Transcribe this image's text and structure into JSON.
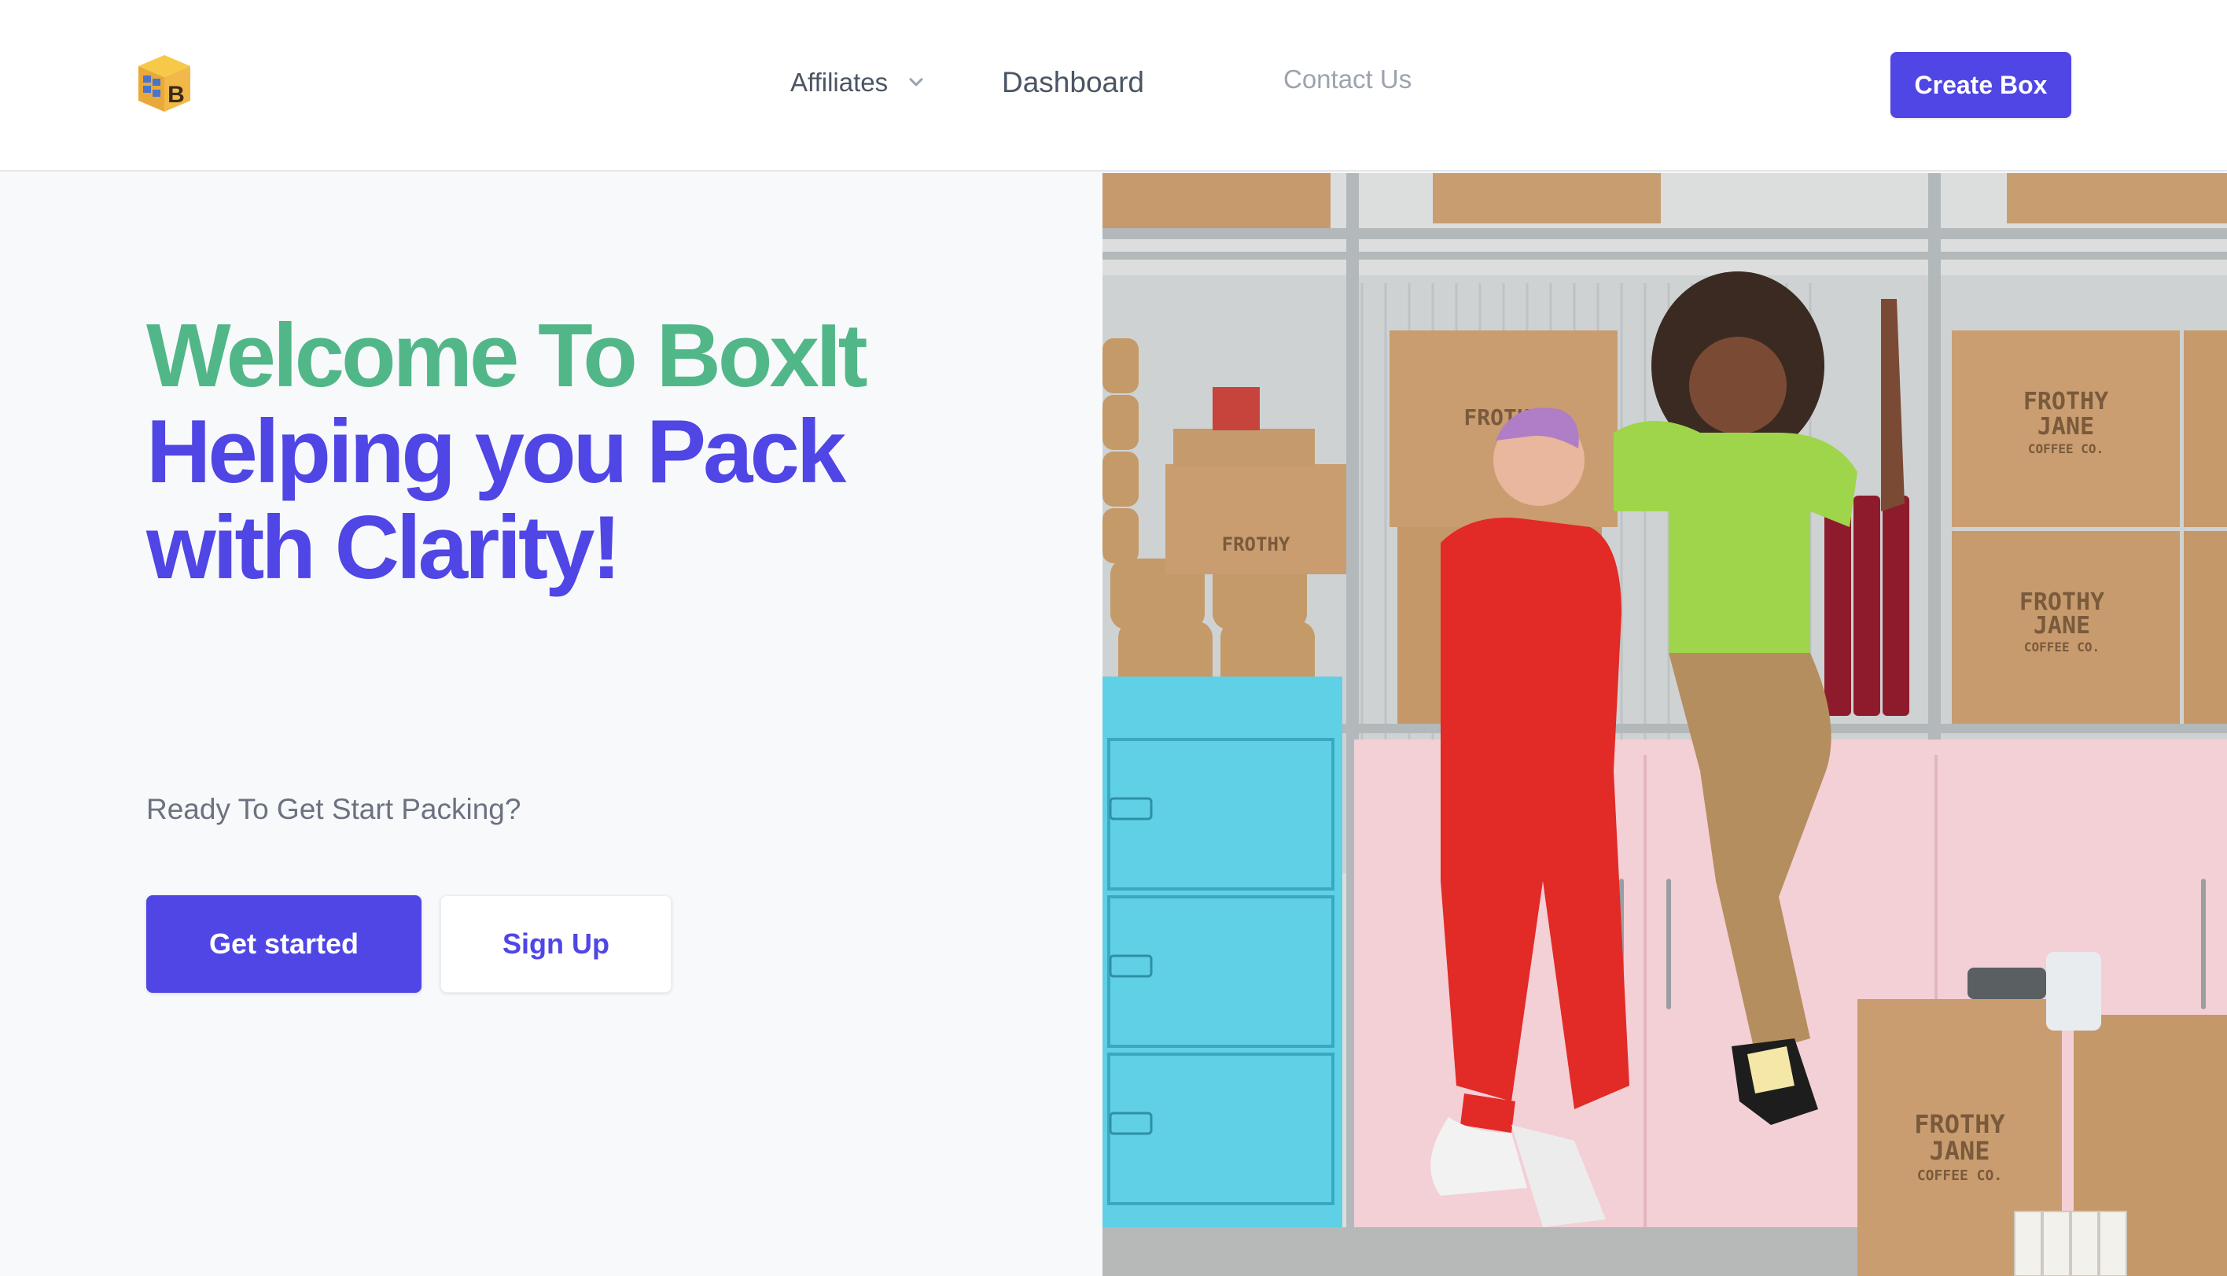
{
  "nav": {
    "logo_icon": "box-b-logo-icon",
    "links": {
      "affiliates": "Affiliates",
      "dashboard": "Dashboard",
      "contact": "Contact Us"
    },
    "cta": "Create Box"
  },
  "hero": {
    "headline_line1": "Welcome To BoxIt",
    "headline_line2": "Helping you Pack",
    "headline_line3": "with Clarity!",
    "subtitle": "Ready To Get Start Packing?",
    "primary_button": "Get started",
    "secondary_button": "Sign Up",
    "box_brand_line1": "FROTHY",
    "box_brand_line2": "JANE",
    "box_brand_line3": "COFFEE CO."
  },
  "colors": {
    "accent": "#4f46e5",
    "headline_green": "#52b788",
    "text_gray": "#6b7280"
  }
}
